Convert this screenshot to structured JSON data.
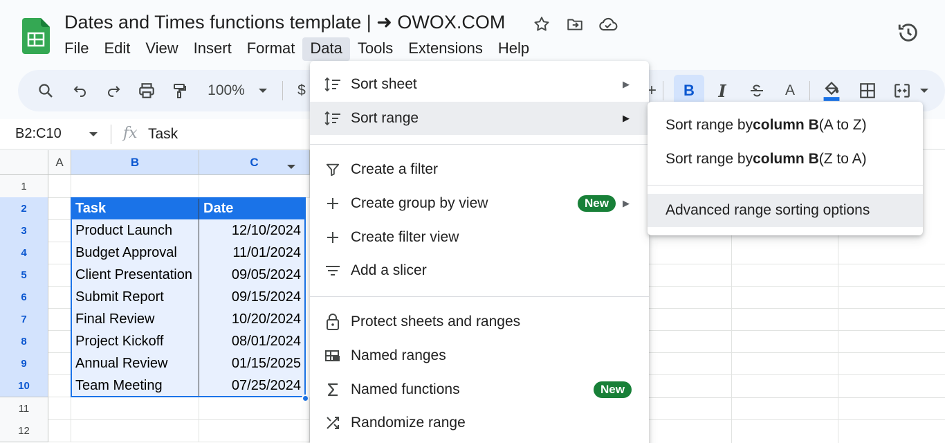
{
  "doc": {
    "title": "Dates and Times functions template | ➜ OWOX.COM"
  },
  "menubar": [
    "File",
    "Edit",
    "View",
    "Insert",
    "Format",
    "Data",
    "Tools",
    "Extensions",
    "Help"
  ],
  "active_menu": "Data",
  "toolbar": {
    "zoom": "100%",
    "currency": "$",
    "plus": "+",
    "bold": "B",
    "italic": "I",
    "text_color": "A"
  },
  "formula_bar": {
    "namebox": "B2:C10",
    "fx": "fx",
    "value": "Task"
  },
  "grid": {
    "columns": [
      "A",
      "B",
      "C"
    ],
    "rows": [
      "1",
      "2",
      "3",
      "4",
      "5",
      "6",
      "7",
      "8",
      "9",
      "10",
      "11",
      "12"
    ],
    "table_header": {
      "task": "Task",
      "date": "Date"
    },
    "table_rows": [
      {
        "task": "Product Launch",
        "date": "12/10/2024"
      },
      {
        "task": "Budget Approval",
        "date": "11/01/2024"
      },
      {
        "task": "Client Presentation",
        "date": "09/05/2024"
      },
      {
        "task": "Submit Report",
        "date": "09/15/2024"
      },
      {
        "task": "Final Review",
        "date": "10/20/2024"
      },
      {
        "task": "Project Kickoff",
        "date": "08/01/2024"
      },
      {
        "task": "Annual Review",
        "date": "01/15/2025"
      },
      {
        "task": "Team Meeting",
        "date": "07/25/2024"
      }
    ]
  },
  "data_menu": {
    "items": [
      {
        "label": "Sort sheet",
        "icon": "sort-icon",
        "submenu": true
      },
      {
        "label": "Sort range",
        "icon": "sort-icon",
        "submenu": true,
        "highlighted": true
      },
      {
        "label": "Create a filter",
        "icon": "filter-icon"
      },
      {
        "label": "Create group by view",
        "icon": "plus-icon",
        "badge": "New",
        "submenu": true
      },
      {
        "label": "Create filter view",
        "icon": "plus-icon"
      },
      {
        "label": "Add a slicer",
        "icon": "slicer-icon"
      },
      {
        "label": "Protect sheets and ranges",
        "icon": "lock-icon"
      },
      {
        "label": "Named ranges",
        "icon": "named-ranges-icon"
      },
      {
        "label": "Named functions",
        "icon": "sigma-icon",
        "badge": "New"
      },
      {
        "label": "Randomize range",
        "icon": "shuffle-icon"
      }
    ]
  },
  "sort_submenu": {
    "items": [
      {
        "prefix": "Sort range by ",
        "bold": "column B",
        "suffix": " (A to Z)"
      },
      {
        "prefix": "Sort range by ",
        "bold": "column B",
        "suffix": " (Z to A)"
      },
      {
        "prefix": "Advanced range sorting options",
        "bold": "",
        "suffix": "",
        "highlighted": true
      }
    ]
  },
  "colors": {
    "accent": "#1a73e8",
    "selection": "#d3e3fd",
    "badge": "#188038",
    "menu_highlight": "#ebedf0"
  }
}
